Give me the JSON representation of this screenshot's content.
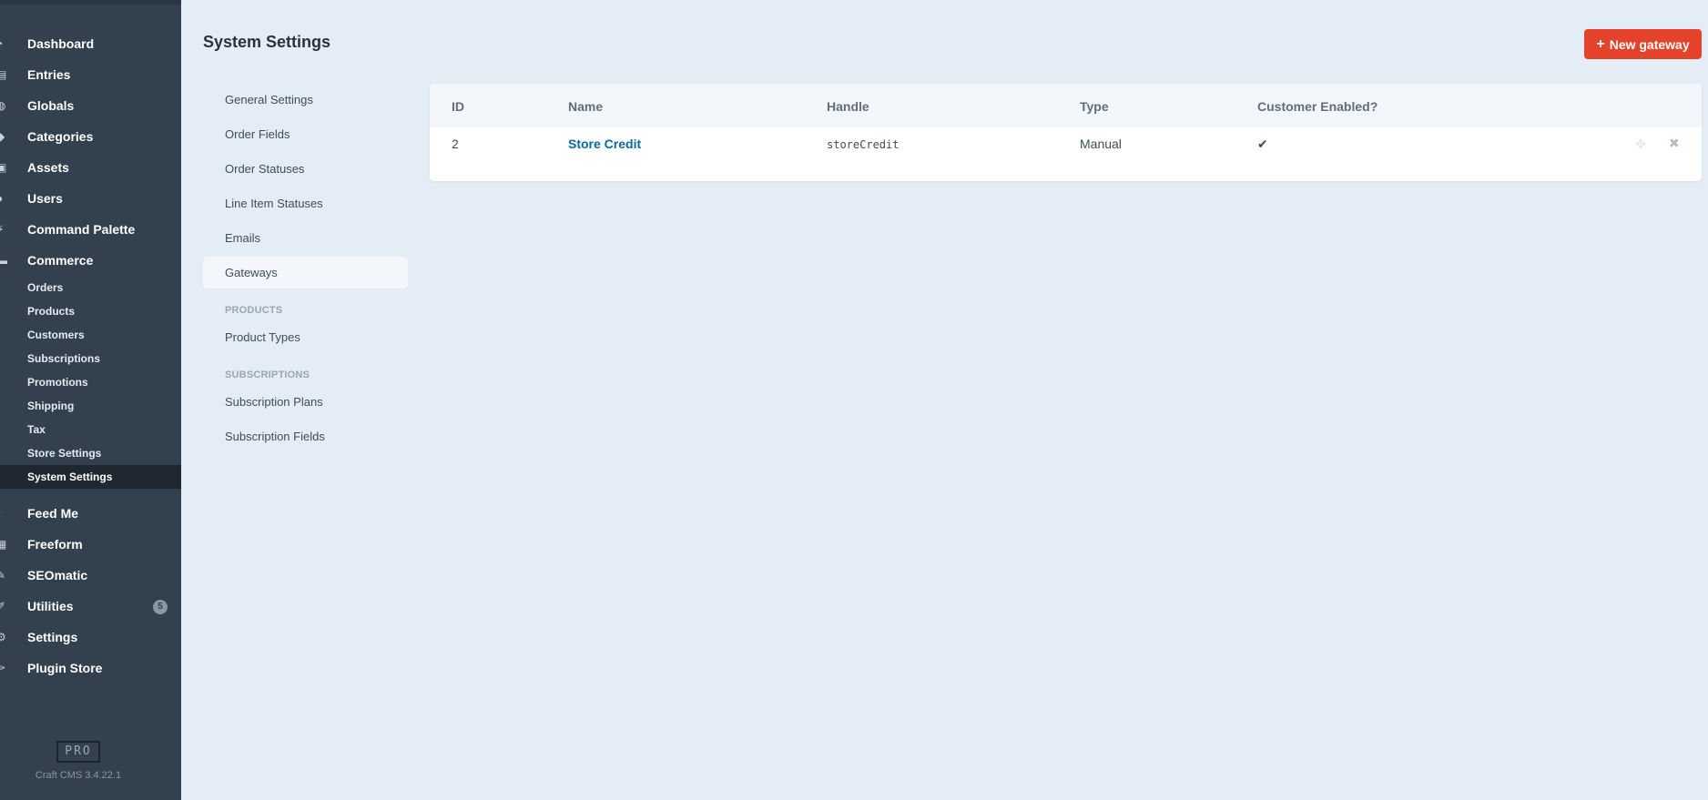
{
  "sidebar": {
    "nav": [
      {
        "label": "Dashboard",
        "icon": "dashboard-icon"
      },
      {
        "label": "Entries",
        "icon": "entries-icon"
      },
      {
        "label": "Globals",
        "icon": "globe-icon"
      },
      {
        "label": "Categories",
        "icon": "categories-icon"
      },
      {
        "label": "Assets",
        "icon": "image-icon"
      },
      {
        "label": "Users",
        "icon": "users-icon"
      },
      {
        "label": "Command Palette",
        "icon": "command-icon"
      },
      {
        "label": "Commerce",
        "icon": "commerce-icon"
      }
    ],
    "commerce_sub": [
      "Orders",
      "Products",
      "Customers",
      "Subscriptions",
      "Promotions",
      "Shipping",
      "Tax",
      "Store Settings",
      "System Settings"
    ],
    "nav_after": [
      {
        "label": "Feed Me",
        "icon": "feed-icon"
      },
      {
        "label": "Freeform",
        "icon": "form-icon"
      },
      {
        "label": "SEOmatic",
        "icon": "seo-icon"
      },
      {
        "label": "Utilities",
        "icon": "wrench-icon",
        "badge": "5"
      },
      {
        "label": "Settings",
        "icon": "gear-icon"
      },
      {
        "label": "Plugin Store",
        "icon": "plug-icon"
      }
    ],
    "edition": "PRO",
    "version": "Craft CMS 3.4.22.1"
  },
  "header": {
    "title": "System Settings",
    "new_button": "New gateway"
  },
  "settings_nav": {
    "items": [
      "General Settings",
      "Order Fields",
      "Order Statuses",
      "Line Item Statuses",
      "Emails",
      "Gateways"
    ],
    "products_heading": "PRODUCTS",
    "products_items": [
      "Product Types"
    ],
    "subscriptions_heading": "SUBSCRIPTIONS",
    "subscriptions_items": [
      "Subscription Plans",
      "Subscription Fields"
    ]
  },
  "table": {
    "columns": [
      "ID",
      "Name",
      "Handle",
      "Type",
      "Customer Enabled?"
    ],
    "rows": [
      {
        "id": "2",
        "name": "Store Credit",
        "handle": "storeCredit",
        "type": "Manual",
        "customer_enabled": true
      }
    ]
  },
  "colors": {
    "sidebar_bg": "#33404d",
    "page_bg": "#e4ecf6",
    "accent_red": "#e5422b",
    "link_blue": "#0b69a3"
  }
}
